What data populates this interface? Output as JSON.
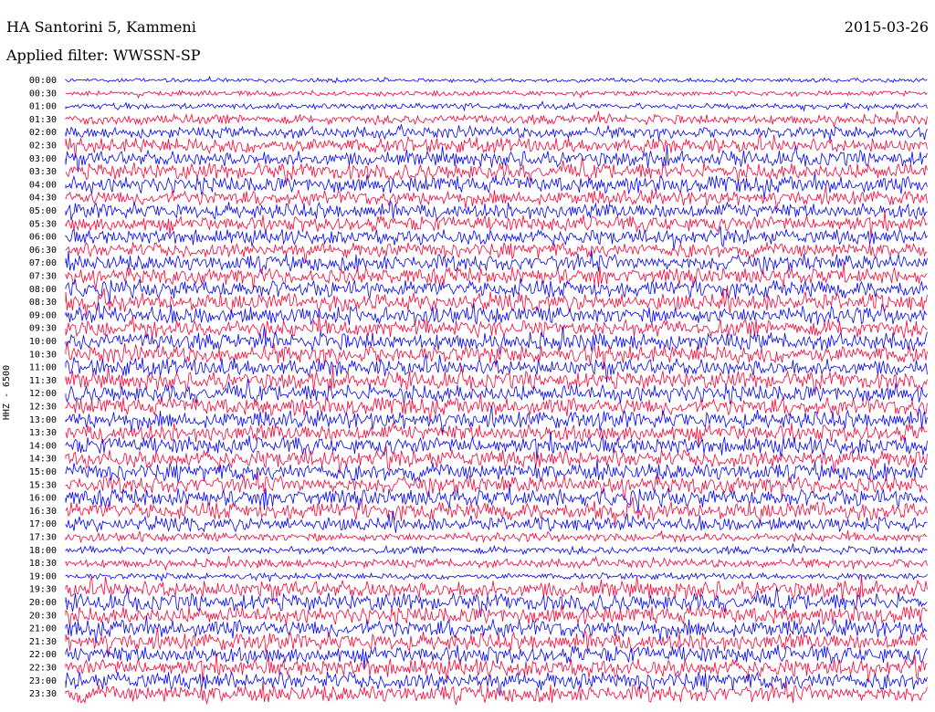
{
  "header": {
    "station": "HA Santorini 5, Kammeni",
    "date": "2015-03-26",
    "filter": "Applied filter: WWSSN-SP"
  },
  "channel_label": "HHZ - 6500",
  "colors": {
    "odd": "#0000ff",
    "even": "#ff0033"
  },
  "chart_data": {
    "type": "line",
    "title": "HA Santorini 5, Kammeni",
    "subtitle": "Applied filter: WWSSN-SP",
    "ylabel": "HHZ - 6500",
    "categories": [
      "00:00",
      "00:30",
      "01:00",
      "01:30",
      "02:00",
      "02:30",
      "03:00",
      "03:30",
      "04:00",
      "04:30",
      "05:00",
      "05:30",
      "06:00",
      "06:30",
      "07:00",
      "07:30",
      "08:00",
      "08:30",
      "09:00",
      "09:30",
      "10:00",
      "10:30",
      "11:00",
      "11:30",
      "12:00",
      "12:30",
      "13:00",
      "13:30",
      "14:00",
      "14:30",
      "15:00",
      "15:30",
      "16:00",
      "16:30",
      "17:00",
      "17:30",
      "18:00",
      "18:30",
      "19:00",
      "19:30",
      "20:00",
      "20:30",
      "21:00",
      "21:30",
      "22:00",
      "22:30",
      "23:00",
      "23:30"
    ],
    "amplitude": [
      0.25,
      0.3,
      0.35,
      0.55,
      0.65,
      0.85,
      0.9,
      0.95,
      0.95,
      0.85,
      0.9,
      0.9,
      0.85,
      0.85,
      0.95,
      0.95,
      1.0,
      1.0,
      1.0,
      1.0,
      1.0,
      1.0,
      1.0,
      1.0,
      1.0,
      1.0,
      1.0,
      1.0,
      1.0,
      1.0,
      1.0,
      1.0,
      1.0,
      1.0,
      0.8,
      0.5,
      0.45,
      0.5,
      0.35,
      1.0,
      1.0,
      1.0,
      1.0,
      1.0,
      1.0,
      1.0,
      1.0,
      1.0
    ],
    "grid": false
  }
}
